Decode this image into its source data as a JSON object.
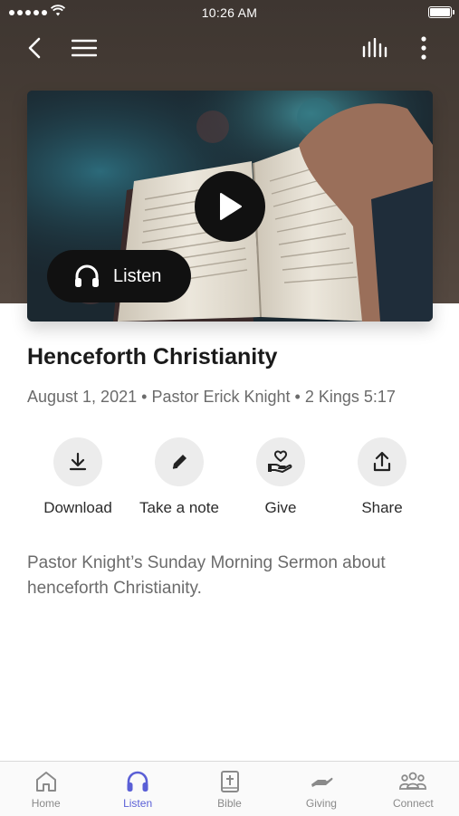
{
  "status_bar": {
    "time": "10:26 AM"
  },
  "media": {
    "listen_label": "Listen"
  },
  "sermon": {
    "title": "Henceforth Christianity",
    "date": "August 1, 2021",
    "pastor": "Pastor Erick Knight",
    "scripture": "2 Kings 5:17",
    "separator": "•",
    "description": "Pastor Knight’s Sunday Morning Sermon about henceforth Christianity."
  },
  "actions": [
    {
      "label": "Download",
      "icon": "download-icon"
    },
    {
      "label": "Take a note",
      "icon": "pencil-icon"
    },
    {
      "label": "Give",
      "icon": "heart-hand-icon"
    },
    {
      "label": "Share",
      "icon": "share-icon"
    }
  ],
  "tabs": [
    {
      "label": "Home",
      "icon": "home-icon",
      "active": false
    },
    {
      "label": "Listen",
      "icon": "headphones-icon",
      "active": true
    },
    {
      "label": "Bible",
      "icon": "bible-icon",
      "active": false
    },
    {
      "label": "Giving",
      "icon": "giving-icon",
      "active": false
    },
    {
      "label": "Connect",
      "icon": "group-icon",
      "active": false
    }
  ],
  "colors": {
    "accent": "#5a5fd6",
    "header_bg": "#4a3f37",
    "pill_bg": "#111111"
  }
}
